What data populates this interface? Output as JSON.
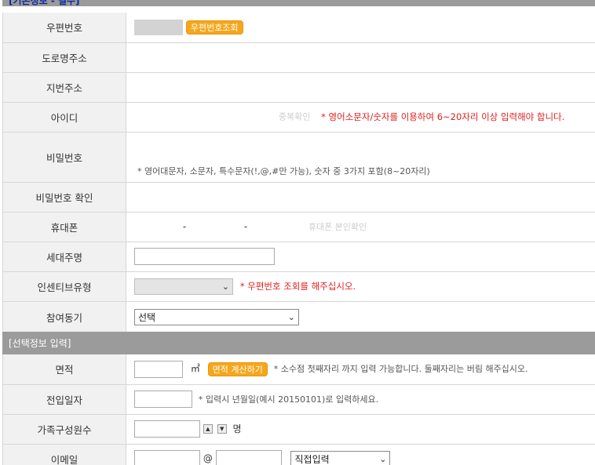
{
  "sections": {
    "basic": "[기본정보 - 필수]",
    "optional": "[선택정보 입력]"
  },
  "rows": {
    "zipcode": {
      "label": "우편번호",
      "button": "우편번호조회"
    },
    "road_address": {
      "label": "도로명주소"
    },
    "lot_address": {
      "label": "지번주소"
    },
    "user_id": {
      "label": "아이디",
      "check": "중복확인",
      "hint": "* 영어소문자/숫자를 이용하여 6~20자리 이상 입력해야 합니다."
    },
    "password": {
      "label": "비밀번호",
      "hint": "* 영어대문자, 소문자, 특수문자(!,@,#만 가능), 숫자 중 3가지 포함(8~20자리)"
    },
    "password_confirm": {
      "label": "비밀번호 확인"
    },
    "mobile": {
      "label": "휴대폰",
      "sep1": "-",
      "sep2": "-",
      "verify": "휴대폰 본인확인"
    },
    "householder": {
      "label": "세대주명"
    },
    "incentive": {
      "label": "인센티브유형",
      "hint": "* 우편번호 조회를 해주십시오."
    },
    "motivation": {
      "label": "참여동기",
      "selected": "선택"
    },
    "area": {
      "label": "면적",
      "unit": "㎡",
      "button": "면적 계산하기",
      "hint": "* 소수점 첫째자리 까지 입력 가능합니다. 둘째자리는 버림 해주십시오."
    },
    "move_in_date": {
      "label": "전입일자",
      "hint": "* 입력시 년월일(예시 20150101)로 입력하세요."
    },
    "family": {
      "label": "가족구성원수",
      "up": "▲",
      "down": "▼",
      "unit": "명"
    },
    "email": {
      "label": "이메일",
      "at": "@",
      "domain_select": "직접입력"
    }
  },
  "colors": {
    "accent_orange": "#f5a71c",
    "section_grey": "#9b9b9b",
    "warning_red": "#e02020"
  }
}
